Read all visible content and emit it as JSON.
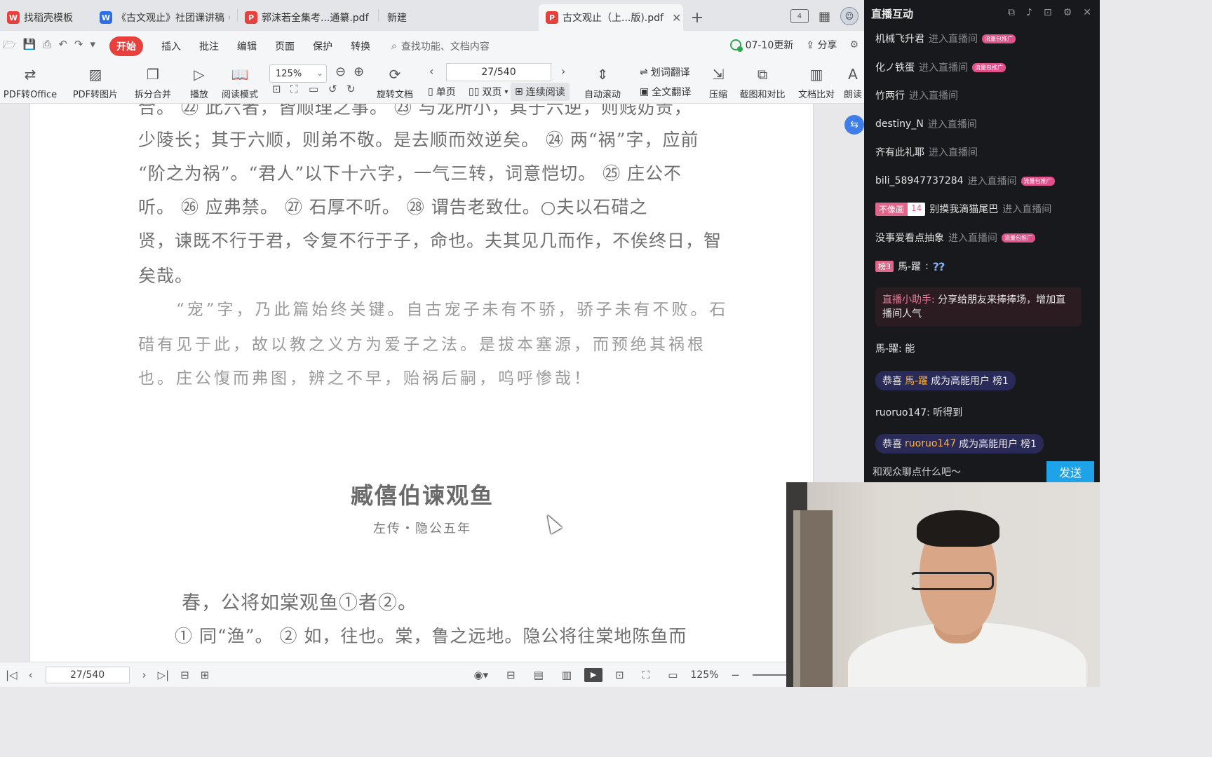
{
  "tabs": [
    {
      "label": "找稻壳模板",
      "icon": "wps-icon",
      "color": "#e8403c"
    },
    {
      "label": "《古文观止》社团课讲稿",
      "icon": "word-icon",
      "color": "#2b6fe8"
    },
    {
      "label": "郭沫若全集考...通纂.pdf",
      "icon": "pdf-icon",
      "color": "#e8403c"
    },
    {
      "label": "新建",
      "icon": "",
      "color": ""
    },
    {
      "label": "古文观止（上...版).pdf",
      "icon": "pdf-icon",
      "color": "#e8403c"
    }
  ],
  "menu": {
    "items": [
      "开始",
      "插入",
      "批注",
      "编辑",
      "页面",
      "保护",
      "转换"
    ],
    "search_placeholder": "查找功能、文档内容",
    "update": "07-10更新",
    "share": "分享"
  },
  "ribbon": {
    "pdf_to_office": "PDF转Office",
    "pdf_to_image": "PDF转图片",
    "split_merge": "拆分合并",
    "play": "播放",
    "read_mode": "阅读模式",
    "zoom": "125%",
    "rotate": "旋转文档",
    "page": "27/540",
    "single": "单页",
    "double": "双页",
    "continuous": "连续阅读",
    "auto_scroll": "自动滚动",
    "word_translate": "划词翻译",
    "full_translate": "全文翻译",
    "compress": "压缩",
    "screenshot_compare": "截图和对比",
    "doc_compare": "文档比对",
    "read_aloud": "朗读"
  },
  "document": {
    "lines": [
      "合。 ㉒ 此六者，皆顺理之事。 ㉓ 与龙所小，其于六逆，则贱妨贵，",
      "少陵长；其于六顺，则弟不敬。是去顺而效逆矣。 ㉔ 两“祸”字，应前",
      "“阶之为祸”。“君人”以下十六字，一气三转，词意恺切。 ㉕ 庄公不",
      "听。 ㉖ 应弗禁。 ㉗ 石厚不听。 ㉘ 谓告老致仕。○夫以石碏之",
      "贤，谏既不行于君，令复不行于子，命也。夫其见几而作，不俟终日，智",
      "矣哉。"
    ],
    "comment_lines": [
      "“宠”字，乃此篇始终关键。自古宠子未有不骄，骄子未有不败。石",
      "碏有见于此，故以教之义方为爱子之法。是拔本塞源，而预绝其祸根",
      "也。庄公愎而弗图，辨之不早，贻祸后嗣，呜呼惨哉！"
    ],
    "title": "臧僖伯谏观鱼",
    "subtitle": "左传・隐公五年",
    "text_line": "春，公将如棠观鱼①者②。",
    "note_line": "① 同“渔”。 ② 如，往也。棠，鲁之远地。隐公将往棠地陈鱼而"
  },
  "statusbar": {
    "page": "27/540",
    "zoom": "125%"
  },
  "live": {
    "title": "直播互动",
    "entering": "进入直播间",
    "users": [
      "机械飞升君",
      "化ノ铁蛋",
      "竹两行",
      "destiny_N",
      "齐有此礼耶",
      "bili_58947737284",
      "别摸我滴猫尾巴",
      "没事爱看点抽象"
    ],
    "promo_tag": "流量包推广",
    "medal_name": "不像画",
    "medal_level": "14",
    "chat1_user": "馬-躍",
    "chat1_level": "榜3",
    "chat1_text": "??",
    "assistant_name": "直播小助手:",
    "assistant_text": "分享给朋友来捧捧场，增加直播间人气",
    "chat2": "馬-躍: 能",
    "congrats_prefix": "恭喜",
    "congrats_suffix": "成为高能用户",
    "congrats_user1": "馬-躍",
    "congrats_user2": "ruoruo147",
    "congrats_badge": "榜1",
    "chat3": "ruoruo147: 听得到",
    "input_placeholder": "和观众聊点什么吧～",
    "send": "发送"
  }
}
